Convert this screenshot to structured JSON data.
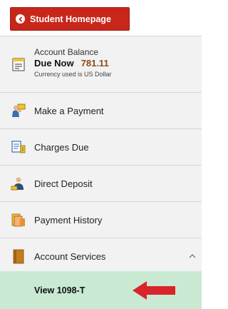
{
  "header": {
    "home_button_label": "Student Homepage"
  },
  "nav": {
    "account_balance": {
      "title": "Account Balance",
      "due_label": "Due Now",
      "due_amount": "781.11",
      "currency_note": "Currency used is US Dollar",
      "icon": "statement-icon"
    },
    "items": [
      {
        "label": "Make a Payment",
        "icon": "payment-icon"
      },
      {
        "label": "Charges Due",
        "icon": "charges-icon"
      },
      {
        "label": "Direct Deposit",
        "icon": "direct-deposit-icon"
      },
      {
        "label": "Payment History",
        "icon": "payment-history-icon"
      },
      {
        "label": "Account Services",
        "icon": "account-services-icon",
        "expanded": true
      }
    ],
    "subitem": {
      "label": "View 1098-T",
      "highlight_color": "#c9e9d2"
    }
  },
  "colors": {
    "home_button": "#c8261b",
    "arrow": "#d8242a",
    "due_amount": "#8a4b1c"
  }
}
